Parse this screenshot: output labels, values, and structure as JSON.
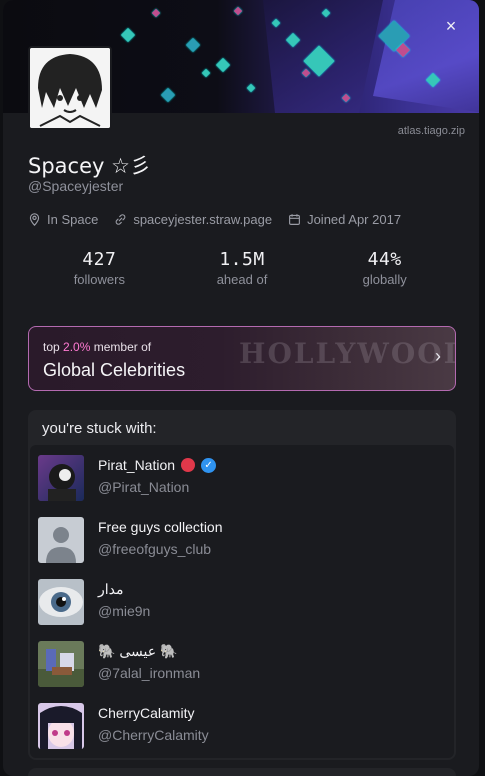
{
  "banner": {
    "watermark": "atlas.tiago.zip",
    "close_glyph": "×"
  },
  "profile": {
    "display_name": "Spacey ☆彡",
    "handle": "@Spaceyjester",
    "location": "In Space",
    "website": "spaceyjester.straw.page",
    "joined": "Joined Apr 2017"
  },
  "stats": [
    {
      "value": "427",
      "label": "followers"
    },
    {
      "value": "1.5M",
      "label": "ahead of"
    },
    {
      "value": "44%",
      "label": "globally"
    }
  ],
  "membership": {
    "top_prefix": "top",
    "percent": "2.0%",
    "member_of": "member of",
    "group_name": "Global Celebrities",
    "bg_word": "HOLLYWOOD"
  },
  "stuck_with": {
    "header": "you're stuck with:",
    "accounts": [
      {
        "name": "Pirat_Nation",
        "handle": "@Pirat_Nation"
      },
      {
        "name": "Free guys collection",
        "handle": "@freeofguys_club"
      },
      {
        "name": "مدار",
        "handle": "@mie9n"
      },
      {
        "name": "🐘 عيسى 🐘",
        "handle": "@7alal_ironman"
      },
      {
        "name": "CherryCalamity",
        "handle": "@CherryCalamity"
      }
    ]
  },
  "colors": {
    "accent_pink": "#ff7ad2",
    "member_border": "#b46ab0",
    "verified_blue": "#2f93f0",
    "red_dot": "#e0384a"
  }
}
